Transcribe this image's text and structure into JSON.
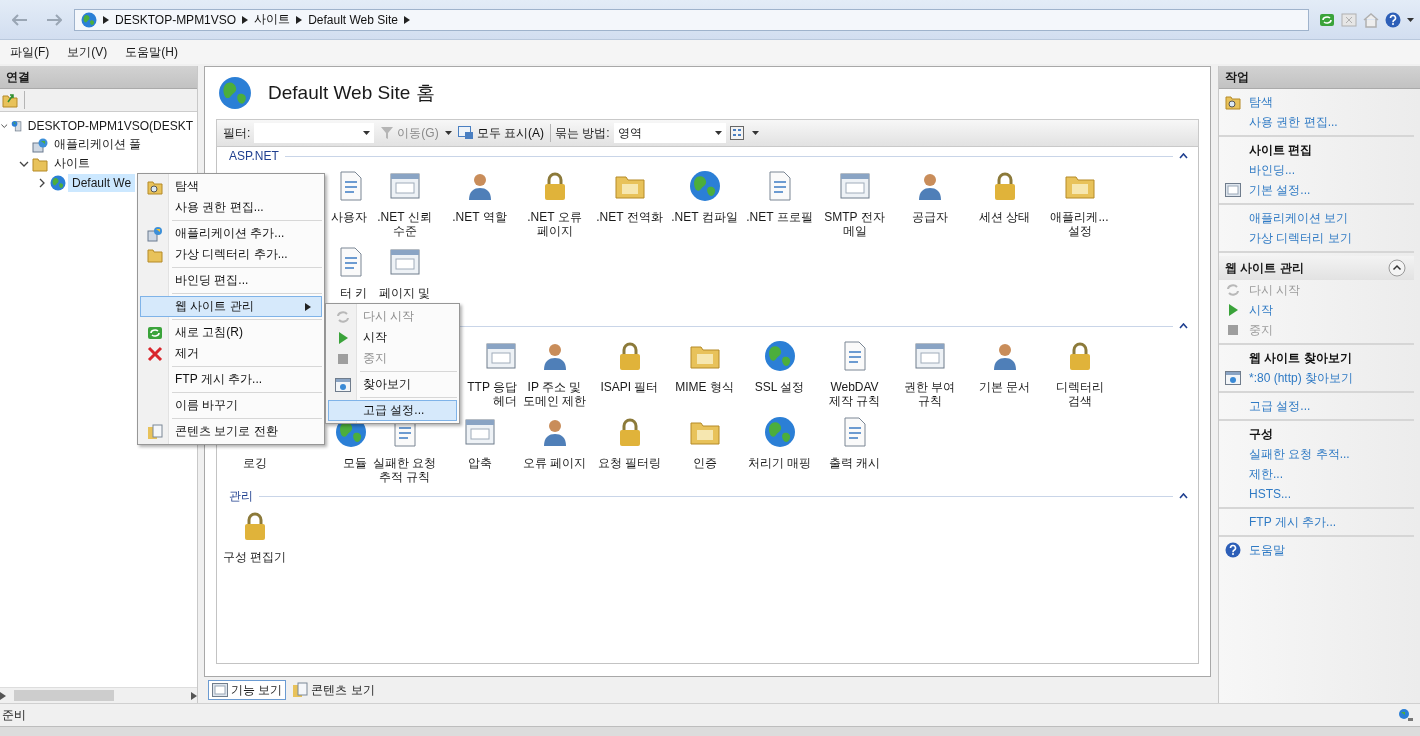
{
  "address": {
    "crumbs": [
      "DESKTOP-MPM1VSO",
      "사이트",
      "Default Web Site"
    ]
  },
  "menu": [
    "파일(F)",
    "보기(V)",
    "도움말(H)"
  ],
  "connections": {
    "title": "연결",
    "tree": [
      {
        "label": "DESKTOP-MPM1VSO(DESKT",
        "kind": "server",
        "expanded": true,
        "selected": false,
        "children": [
          {
            "label": "애플리케이션 풀",
            "kind": "pool",
            "selected": false
          },
          {
            "label": "사이트",
            "kind": "sites",
            "expanded": true,
            "selected": false,
            "children": [
              {
                "label": "Default We",
                "kind": "site",
                "expanded": false,
                "selected": true
              }
            ]
          }
        ]
      }
    ]
  },
  "page": {
    "title": "Default Web Site 홈",
    "toolbar": {
      "filter_label": "필터:",
      "go_button": {
        "label": "이동(G)",
        "disabled": true
      },
      "show_all_button": {
        "label": "모두 표시(A)",
        "disabled": false
      },
      "group_by_label": "묶는 방법:",
      "group_by_value": "영역"
    },
    "sections": [
      {
        "title": "ASP.NET",
        "expanded": true,
        "items": [
          {
            "kind": "covered"
          },
          {
            "kind": "cut",
            "label": "사용자"
          },
          {
            "kind": "full",
            "label": ".NET 신뢰 수준"
          },
          {
            "kind": "full",
            "label": ".NET 역할"
          },
          {
            "kind": "full",
            "label": ".NET 오류 페이지"
          },
          {
            "kind": "full",
            "label": ".NET 전역화"
          },
          {
            "kind": "full",
            "label": ".NET 컴파일"
          },
          {
            "kind": "full",
            "label": ".NET 프로필"
          },
          {
            "kind": "full",
            "label": "SMTP 전자 메일"
          },
          {
            "kind": "full",
            "label": "공급자"
          },
          {
            "kind": "full",
            "label": "세션 상태"
          },
          {
            "kind": "full",
            "label": "애플리케... 설정"
          },
          {
            "kind": "covered"
          },
          {
            "kind": "cut",
            "label": "터 키"
          },
          {
            "kind": "full",
            "label": "페이지 및"
          }
        ]
      },
      {
        "expanded": true,
        "items": [
          {
            "kind": "covered"
          },
          {
            "kind": "covered"
          },
          {
            "kind": "covered"
          },
          {
            "kind": "cut",
            "label": "TTP 응답 헤더"
          },
          {
            "kind": "full",
            "label": "IP 주소 및 도메인 제한"
          },
          {
            "kind": "full",
            "label": "ISAPI 필터"
          },
          {
            "kind": "full",
            "label": "MIME 형식"
          },
          {
            "kind": "full",
            "label": "SSL 설정"
          },
          {
            "kind": "full",
            "label": "WebDAV 제작 규칙"
          },
          {
            "kind": "full",
            "label": "권한 부여 규칙"
          },
          {
            "kind": "full",
            "label": "기본 문서"
          },
          {
            "kind": "full",
            "label": "디렉터리 검색"
          },
          {
            "kind": "label-only",
            "label": "로깅"
          },
          {
            "kind": "cut",
            "label": "모듈"
          },
          {
            "kind": "full",
            "label": "실패한 요청 추적 규칙"
          },
          {
            "kind": "full",
            "label": "압축"
          },
          {
            "kind": "full",
            "label": "오류 페이지"
          },
          {
            "kind": "full",
            "label": "요청 필터링"
          },
          {
            "kind": "full",
            "label": "인증"
          },
          {
            "kind": "full",
            "label": "처리기 매핑"
          },
          {
            "kind": "full",
            "label": "출력 캐시"
          }
        ]
      },
      {
        "title": "관리",
        "expanded": true,
        "items": [
          {
            "kind": "full",
            "label": "구성 편집기"
          }
        ]
      }
    ]
  },
  "view_tabs": [
    {
      "label": "기능 보기",
      "selected": true
    },
    {
      "label": "콘텐츠 보기",
      "selected": false
    }
  ],
  "actions": {
    "title": "작업",
    "groups": [
      {
        "items": [
          {
            "kind": "explore",
            "label": "탐색",
            "disabled": false
          },
          {
            "kind": "link",
            "label": "사용 권한 편집...",
            "disabled": false
          }
        ]
      },
      {
        "items": [
          {
            "kind": "heading",
            "label": "사이트 편집",
            "disabled": false
          },
          {
            "kind": "link",
            "label": "바인딩...",
            "disabled": false
          },
          {
            "kind": "settings",
            "label": "기본 설정...",
            "disabled": false
          }
        ]
      },
      {
        "items": [
          {
            "kind": "link",
            "label": "애플리케이션 보기",
            "disabled": false
          },
          {
            "kind": "link",
            "label": "가상 디렉터리 보기",
            "disabled": false
          }
        ]
      },
      {
        "header": {
          "label": "웹 사이트 관리",
          "expanded": true
        },
        "items": [
          {
            "kind": "restart",
            "label": "다시 시작",
            "disabled": true
          },
          {
            "kind": "start",
            "label": "시작",
            "disabled": false
          },
          {
            "kind": "stop",
            "label": "중지",
            "disabled": true
          }
        ]
      },
      {
        "items": [
          {
            "kind": "heading",
            "label": "웹 사이트 찾아보기",
            "disabled": false
          },
          {
            "kind": "browse",
            "label": "*:80 (http) 찾아보기",
            "disabled": false
          }
        ]
      },
      {
        "items": [
          {
            "kind": "link",
            "label": "고급 설정...",
            "disabled": false
          }
        ]
      },
      {
        "items": [
          {
            "kind": "heading",
            "label": "구성",
            "disabled": false
          },
          {
            "kind": "link",
            "label": "실패한 요청 추적...",
            "disabled": false
          },
          {
            "kind": "link",
            "label": "제한...",
            "disabled": false
          },
          {
            "kind": "link",
            "label": "HSTS...",
            "disabled": false
          }
        ]
      },
      {
        "items": [
          {
            "kind": "link",
            "label": "FTP 게시 추가...",
            "disabled": false
          }
        ]
      },
      {
        "items": [
          {
            "kind": "help",
            "label": "도움말",
            "disabled": false
          }
        ]
      }
    ]
  },
  "context_menu": {
    "groups": [
      [
        {
          "kind": "explore",
          "label": "탐색",
          "selected": false
        },
        {
          "kind": "plain",
          "label": "사용 권한 편집...",
          "selected": false
        }
      ],
      [
        {
          "kind": "add-app",
          "label": "애플리케이션 추가...",
          "selected": false
        },
        {
          "kind": "add-dir",
          "label": "가상 디렉터리 추가...",
          "selected": false
        }
      ],
      [
        {
          "kind": "plain",
          "label": "바인딩 편집...",
          "selected": false
        }
      ],
      [
        {
          "kind": "submenu",
          "label": "웹 사이트 관리",
          "selected": true
        }
      ],
      [
        {
          "kind": "refresh",
          "label": "새로 고침(R)",
          "selected": false
        },
        {
          "kind": "remove",
          "label": "제거",
          "selected": false
        }
      ],
      [
        {
          "kind": "plain",
          "label": "FTP 게시 추가...",
          "selected": false
        }
      ],
      [
        {
          "kind": "plain",
          "label": "이름 바꾸기",
          "selected": false
        }
      ],
      [
        {
          "kind": "switch",
          "label": "콘텐츠 보기로 전환",
          "selected": false
        }
      ]
    ]
  },
  "submenu": {
    "groups": [
      [
        {
          "kind": "restart",
          "label": "다시 시작",
          "disabled": true,
          "selected": false
        },
        {
          "kind": "start",
          "label": "시작",
          "disabled": false,
          "selected": false
        },
        {
          "kind": "stop",
          "label": "중지",
          "disabled": true,
          "selected": false
        }
      ],
      [
        {
          "kind": "browse",
          "label": "찾아보기",
          "disabled": false,
          "selected": false
        }
      ],
      [
        {
          "kind": "plain",
          "label": "고급 설정...",
          "disabled": false,
          "selected": true
        }
      ]
    ]
  },
  "status": "준비"
}
